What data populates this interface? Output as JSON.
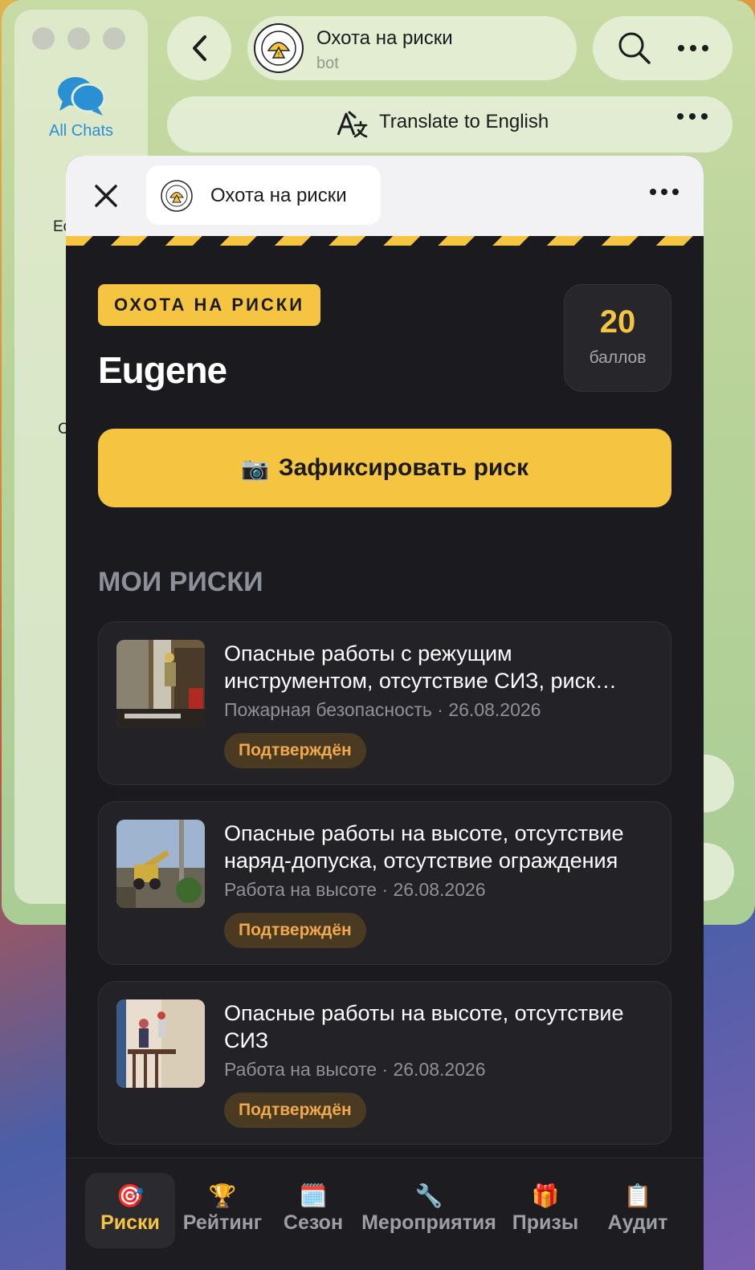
{
  "telegram": {
    "sidebar": {
      "all_chats_label": "All Chats",
      "folders": [
        "Eco",
        "C",
        "Ch"
      ]
    },
    "chat_header": {
      "bot_name": "Охота на риски",
      "bot_subtitle": "bot"
    },
    "translate_bar": {
      "label": "Translate to English"
    }
  },
  "mini_app": {
    "tab_title": "Охота на риски",
    "brand_badge": "ОХОТА НА РИСКИ",
    "username": "Eugene",
    "score": {
      "value": "20",
      "unit": "баллов"
    },
    "primary_button": {
      "icon": "📷",
      "label": "Зафиксировать риск"
    },
    "section_title": "МОИ РИСКИ",
    "risks": [
      {
        "title": "Опасные работы с режущим инструментом, отсутствие СИЗ, риск возгорания",
        "category": "Пожарная безопасность",
        "date": "26.08.2026",
        "meta": "Пожарная безопасность · 26.08.2026",
        "status": "Подтверждён"
      },
      {
        "title": "Опасные работы на высоте, отсутствие наряд-допуска, отсутствие ограждения",
        "category": "Работа на высоте",
        "date": "26.08.2026",
        "meta": "Работа на высоте · 26.08.2026",
        "status": "Подтверждён"
      },
      {
        "title": "Опасные работы на высоте, отсутствие СИЗ",
        "category": "Работа на высоте",
        "date": "26.08.2026",
        "meta": "Работа на высоте · 26.08.2026",
        "status": "Подтверждён"
      }
    ],
    "nav": [
      {
        "icon": "🎯",
        "label": "Риски",
        "active": true
      },
      {
        "icon": "🏆",
        "label": "Рейтинг",
        "active": false
      },
      {
        "icon": "🗓️",
        "label": "Сезон",
        "active": false
      },
      {
        "icon": "🔧",
        "label": "Мероприятия",
        "active": false
      },
      {
        "icon": "🎁",
        "label": "Призы",
        "active": false
      },
      {
        "icon": "📋",
        "label": "Аудит",
        "active": false
      }
    ]
  },
  "colors": {
    "accent_yellow": "#f5c542",
    "app_background": "#1b1b1f",
    "card_background": "#232327",
    "status_text": "#f0a94a",
    "link_blue": "#2b8fd4"
  }
}
